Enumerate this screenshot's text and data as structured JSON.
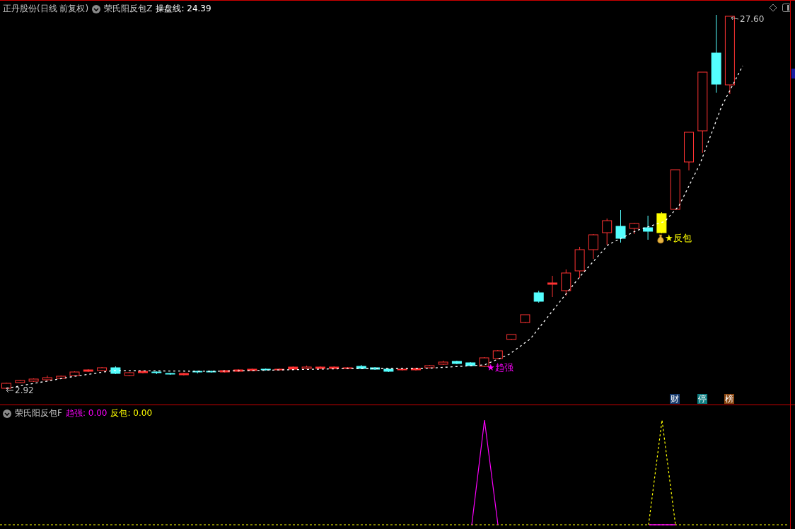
{
  "title_bar": {
    "stock": "正丹股份(日线 前复权)",
    "indicator": "荣氏阳反包Z",
    "reading": "操盘线: 24.39"
  },
  "price_chart": {
    "high_label": "27.60",
    "low_label": "2.92",
    "signals": [
      {
        "kind": "strong",
        "text": "★趋强"
      },
      {
        "kind": "rebound",
        "text": "★反包"
      }
    ],
    "badges": [
      {
        "text": "财",
        "color": "#163a6c"
      },
      {
        "text": "停",
        "color": "#0d7c80"
      },
      {
        "text": "榜",
        "color": "#8a4712"
      }
    ]
  },
  "sub_panel": {
    "indicator": "荣氏阳反包F",
    "lines": [
      {
        "text": "趋强: 0.00",
        "color": "#ff00ff"
      },
      {
        "text": "反包: 0.00",
        "color": "#ffff00"
      }
    ]
  }
}
